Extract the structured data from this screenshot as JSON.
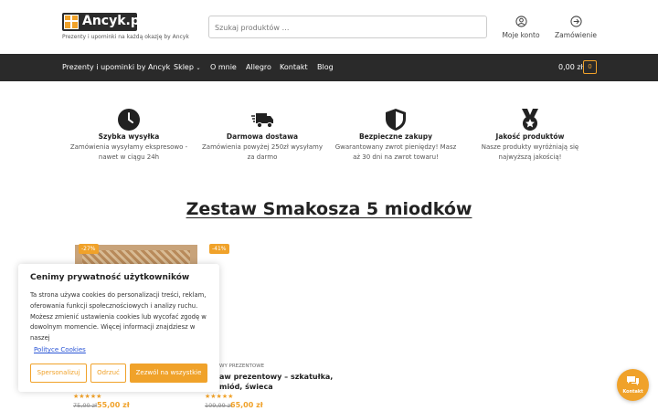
{
  "header": {
    "logo_text": "Ancyk.pl",
    "tagline": "Prezenty i upominki na każdą okazję by Ancyk",
    "search_placeholder": "Szukaj produktów …",
    "account_label": "Moje konto",
    "order_label": "Zamówienie"
  },
  "nav": {
    "items": [
      "Prezenty i upominki by Ancyk",
      "Sklep",
      "O mnie",
      "Allegro",
      "Kontakt",
      "Blog"
    ],
    "cart_total": "0,00 zł",
    "cart_count": "0"
  },
  "features": [
    {
      "icon": "clock-icon",
      "title": "Szybka wysyłka",
      "text": "Zamówienia wysyłamy ekspresowo - nawet w ciągu 24h"
    },
    {
      "icon": "truck-icon",
      "title": "Darmowa dostawa",
      "text": "Zamówienia powyżej 250zł wysyłamy za darmo"
    },
    {
      "icon": "shield-icon",
      "title": "Bezpieczne zakupy",
      "text": "Gwarantowany zwrot pieniędzy! Masz aż 30 dni na zwrot towaru!"
    },
    {
      "icon": "medal-icon",
      "title": "Jakość produktów",
      "text": "Nasze produkty wyróżniają się najwyższą jakością!"
    }
  ],
  "page_title": "Zestaw Smakosza 5 miodków",
  "products": [
    {
      "badge": "-27%",
      "category": "",
      "name": "",
      "rating": "★★★★★",
      "old_price": "75,00 zł",
      "price": "55,00 zł"
    },
    {
      "badge": "-41%",
      "category": "WY PREZENTOWE",
      "name": "aw prezentowy – szkatułka, miód, świeca",
      "rating": "★★★★★",
      "old_price": "109,99 zł",
      "price": "65,00 zł"
    }
  ],
  "cookie": {
    "title": "Cenimy prywatność użytkowników",
    "text": "Ta strona używa cookies do personalizacji treści, reklam, oferowania funkcji społecznościowych i analizy ruchu. Możesz zmienić ustawienia cookies lub wycofać zgodę w dowolnym momencie. Więcej informacji znajdziesz w naszej",
    "link": "Polityce Cookies",
    "btn_customize": "Spersonalizuj",
    "btn_reject": "Odrzuć",
    "btn_accept": "Zezwól na wszystkie"
  },
  "chat": {
    "label": "Kontakt"
  },
  "colors": {
    "accent": "#f0a22a",
    "nav_bg": "#2a2a2a",
    "link": "#2a55d6"
  }
}
